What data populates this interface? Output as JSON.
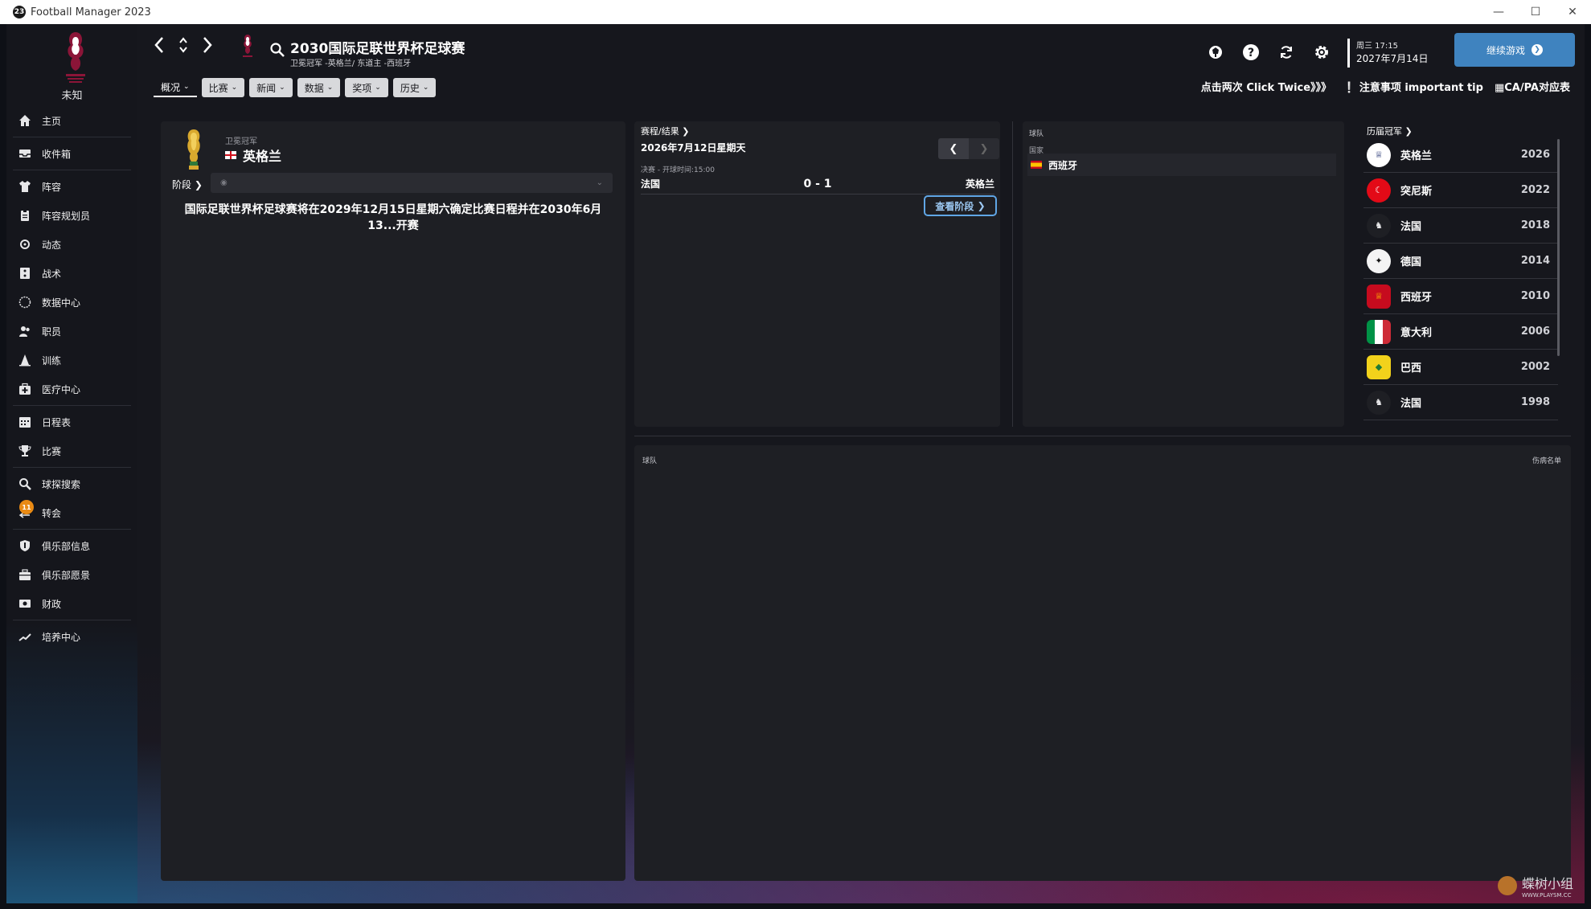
{
  "window": {
    "title": "Football Manager 2023",
    "app_icon_text": "23"
  },
  "sidebar": {
    "status": "未知",
    "items": [
      {
        "label": "主页",
        "icon": "home-icon"
      },
      {
        "label": "收件箱",
        "icon": "inbox-icon"
      },
      {
        "label": "阵容",
        "icon": "squad-shirt-icon"
      },
      {
        "label": "阵容规划员",
        "icon": "clipboard-icon"
      },
      {
        "label": "动态",
        "icon": "dynamics-icon"
      },
      {
        "label": "战术",
        "icon": "tactics-icon"
      },
      {
        "label": "数据中心",
        "icon": "data-hub-icon"
      },
      {
        "label": "职员",
        "icon": "staff-icon"
      },
      {
        "label": "训练",
        "icon": "training-cone-icon"
      },
      {
        "label": "医疗中心",
        "icon": "medical-kit-icon"
      },
      {
        "label": "日程表",
        "icon": "calendar-icon"
      },
      {
        "label": "比赛",
        "icon": "trophy-icon"
      },
      {
        "label": "球探搜索",
        "icon": "scout-search-icon"
      },
      {
        "label": "转会",
        "icon": "transfer-icon",
        "badge": "11"
      },
      {
        "label": "俱乐部信息",
        "icon": "shield-icon"
      },
      {
        "label": "俱乐部愿景",
        "icon": "vision-icon"
      },
      {
        "label": "财政",
        "icon": "finance-icon"
      },
      {
        "label": "培养中心",
        "icon": "development-icon"
      }
    ]
  },
  "header": {
    "title": "2030国际足联世界杯足球赛",
    "subtitle": "卫冕冠军 -英格兰/ 东道主 -西班牙",
    "tabs": [
      {
        "label": "概况",
        "active": true
      },
      {
        "label": "比赛",
        "active": false
      },
      {
        "label": "新闻",
        "active": false
      },
      {
        "label": "数据",
        "active": false
      },
      {
        "label": "奖项",
        "active": false
      },
      {
        "label": "历史",
        "active": false
      }
    ],
    "day": "周三 17:15",
    "date": "2027年7月14日",
    "continue_label": "继续游戏",
    "tips": [
      "点击两次 Click Twice》》》",
      "注意事项  important tip",
      "CA/PA对应表"
    ]
  },
  "holder": {
    "label": "卫冕冠军",
    "team": "英格兰"
  },
  "stage": {
    "label": "阶段",
    "value": ""
  },
  "left_message": "国际足联世界杯足球赛将在2029年12月15日星期六确定比赛日程并在2030年6月13...开赛",
  "fixtures": {
    "heading": "赛程/结果",
    "date": "2026年7月12日星期天",
    "kickoff": "决赛 - 开球时间:15:00",
    "home": "法国",
    "score": "0 - 1",
    "away": "英格兰",
    "view_stage_label": "查看阶段"
  },
  "teams": {
    "heading": "球队",
    "subheading": "国家",
    "team": "西班牙"
  },
  "champions": {
    "heading": "历届冠军",
    "rows": [
      {
        "team": "英格兰",
        "year": "2026"
      },
      {
        "team": "突尼斯",
        "year": "2022"
      },
      {
        "team": "法国",
        "year": "2018"
      },
      {
        "team": "德国",
        "year": "2014"
      },
      {
        "team": "西班牙",
        "year": "2010"
      },
      {
        "team": "意大利",
        "year": "2006"
      },
      {
        "team": "巴西",
        "year": "2002"
      },
      {
        "team": "法国",
        "year": "1998"
      }
    ]
  },
  "bottom_panel": {
    "team_label": "球队",
    "injury_label": "伤病名单"
  },
  "watermark": {
    "text": "蝶树小组",
    "url": "WWW.PLAYSM.CC"
  },
  "colors": {
    "accent": "#3f83bf",
    "badge": "#e98a14",
    "panel": "#1e1f24",
    "background": "#16171d"
  }
}
